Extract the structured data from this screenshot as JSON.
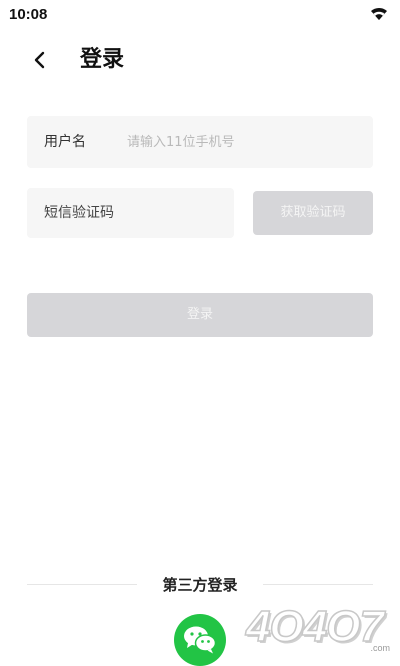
{
  "status_bar": {
    "time": "10:08",
    "wifi_icon": "wifi-icon"
  },
  "header": {
    "back_icon": "chevron-left-icon",
    "title": "登录"
  },
  "form": {
    "username_label": "用户名",
    "username_placeholder": "请输入11位手机号",
    "username_value": "",
    "sms_placeholder": "短信验证码",
    "sms_value": "",
    "get_code_label": "获取验证码",
    "login_label": "登录"
  },
  "third_party": {
    "label": "第三方登录",
    "wechat_icon": "wechat-icon",
    "wechat_color": "#22c445"
  },
  "watermark": {
    "text": "4O4O7",
    "sub": ".com"
  },
  "colors": {
    "disabled_button": "#d6d6d9",
    "field_background": "#f6f6f6"
  }
}
